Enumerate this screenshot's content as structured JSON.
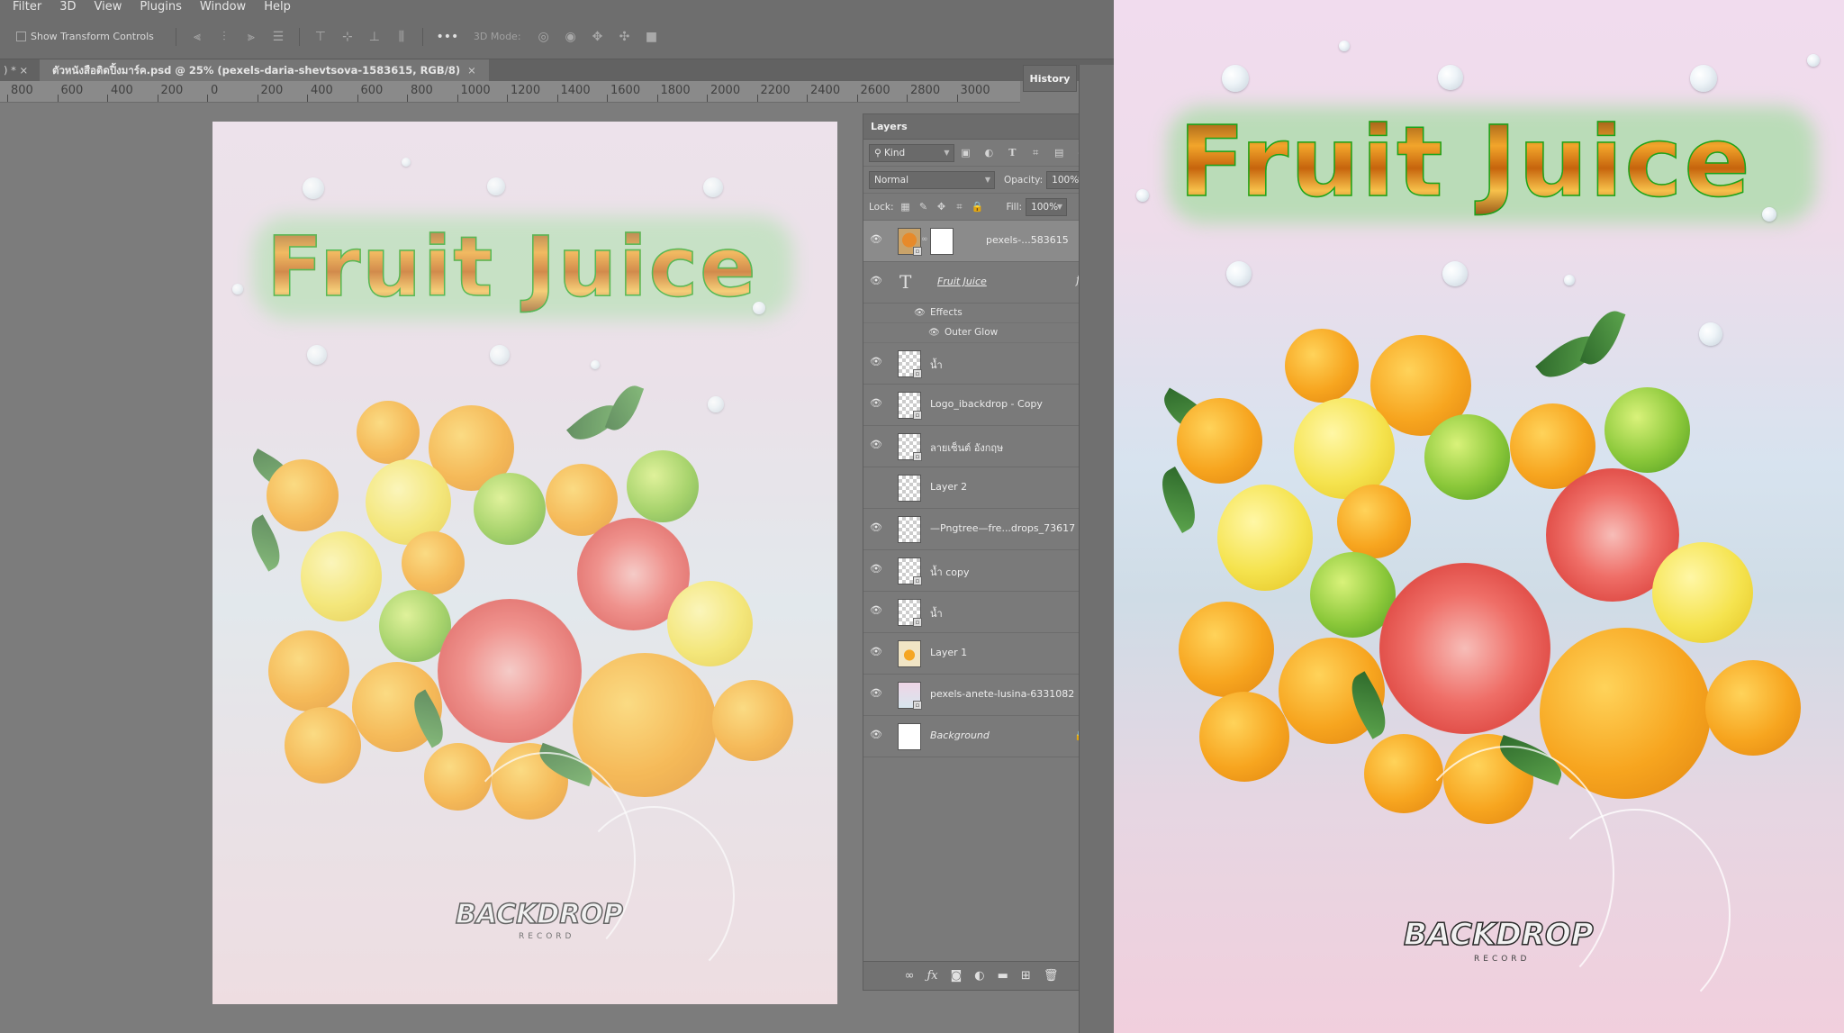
{
  "menu": [
    "Filter",
    "3D",
    "View",
    "Plugins",
    "Window",
    "Help"
  ],
  "options": {
    "show_transform_label": "Show Transform Controls",
    "more": "•••",
    "mode3d_label": "3D Mode:"
  },
  "tabs": {
    "prev_label": ") * ×",
    "active_label": "ตัวหนังสือติดปิ้งมาร์ค.psd @ 25% (pexels-daria-shevtsova-1583615, RGB/8)",
    "close": "×"
  },
  "ruler_labels": [
    "800",
    "600",
    "400",
    "200",
    "0",
    "200",
    "400",
    "600",
    "800",
    "1000",
    "1200",
    "1400",
    "1600",
    "1800",
    "2000",
    "2200",
    "2400",
    "2600",
    "2800",
    "3000"
  ],
  "history": {
    "tab_label": "History"
  },
  "layers_panel": {
    "tab_label": "Layers",
    "menu_icon": "≡",
    "filter_kind": "Kind",
    "blend_mode": "Normal",
    "opacity_label": "Opacity:",
    "opacity_value": "100%",
    "lock_label": "Lock:",
    "fill_label": "Fill:",
    "fill_value": "100%",
    "layers": [
      {
        "name": "pexels-...583615"
      },
      {
        "name": "Fruit Juice"
      },
      {
        "name": "น้ำ"
      },
      {
        "name": "Logo_ibackdrop - Copy"
      },
      {
        "name": "ลายเซ็นต์ อังกฤษ"
      },
      {
        "name": "Layer 2"
      },
      {
        "name": "—Pngtree—fre...drops_73617"
      },
      {
        "name": "น้ำ copy"
      },
      {
        "name": "น้ำ"
      },
      {
        "name": "Layer 1"
      },
      {
        "name": "pexels-anete-lusina-6331082"
      },
      {
        "name": "Background"
      }
    ],
    "effects_label": "Effects",
    "outer_glow_label": "Outer Glow",
    "fx_label": "fx"
  },
  "poster": {
    "title": "Fruit Juice",
    "logo_text": "BACKDROP",
    "logo_sub": "RECORD"
  },
  "colors": {
    "title_stroke": "#18a51d",
    "ps_bg": "#7c7c7c",
    "panel_bg": "#7a7a7a"
  }
}
